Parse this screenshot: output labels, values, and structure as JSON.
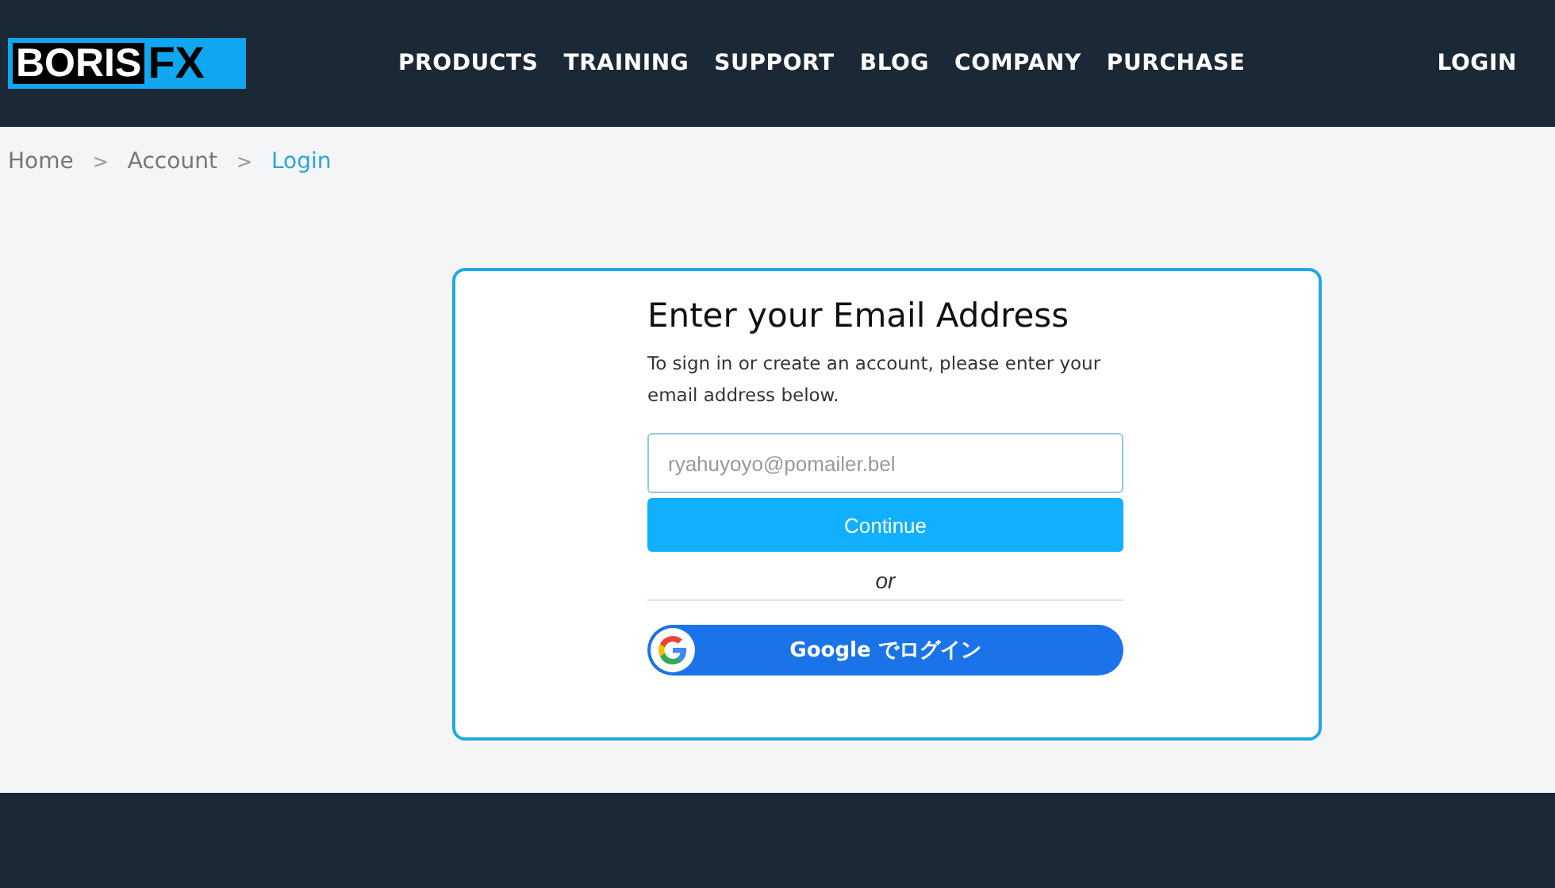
{
  "logo": {
    "word": "BORIS",
    "mark": "FX"
  },
  "nav": [
    {
      "label": "PRODUCTS"
    },
    {
      "label": "TRAINING"
    },
    {
      "label": "SUPPORT"
    },
    {
      "label": "BLOG"
    },
    {
      "label": "COMPANY"
    },
    {
      "label": "PURCHASE"
    }
  ],
  "login_link": "LOGIN",
  "breadcrumb": [
    {
      "label": "Home",
      "selected": false
    },
    {
      "label": "Account",
      "selected": false
    },
    {
      "label": "Login",
      "selected": true
    }
  ],
  "breadcrumb_separator": ">",
  "form": {
    "title": "Enter your Email Address",
    "description": "To sign in or create an account, please enter your email address below.",
    "email_value": "ryahuyoyo@pomailer.bel",
    "continue_button": "Continue",
    "divider_text": "or",
    "google_button": "Google でログイン"
  }
}
